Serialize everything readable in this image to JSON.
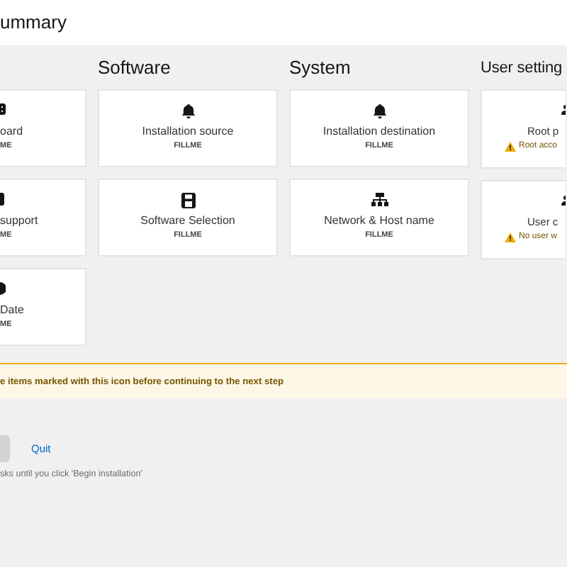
{
  "header": {
    "title": "ummary"
  },
  "sections": [
    {
      "cards": [
        {
          "title": "oard",
          "status": "ME",
          "kind": "info"
        },
        {
          "title": "support",
          "status": "ME",
          "kind": "info"
        },
        {
          "title": "Date",
          "status": "ME",
          "kind": "info"
        }
      ]
    },
    {
      "heading": "Software",
      "cards": [
        {
          "title": "Installation source",
          "status": "FILLME",
          "kind": "info"
        },
        {
          "title": "Software Selection",
          "status": "FILLME",
          "kind": "info"
        }
      ]
    },
    {
      "heading": "System",
      "cards": [
        {
          "title": "Installation destination",
          "status": "FILLME",
          "kind": "info"
        },
        {
          "title": "Network & Host name",
          "status": "FILLME",
          "kind": "info"
        }
      ]
    },
    {
      "heading": "User setting",
      "cards": [
        {
          "title": "Root p",
          "status": "Root acco",
          "kind": "warning"
        },
        {
          "title": "User c",
          "status": "No user w",
          "kind": "warning"
        }
      ]
    }
  ],
  "warning_bar": {
    "text": "e items marked with this icon before continuing to the next step"
  },
  "footer": {
    "quit_link": "Quit",
    "hint": "sks until you click 'Begin installation'"
  }
}
